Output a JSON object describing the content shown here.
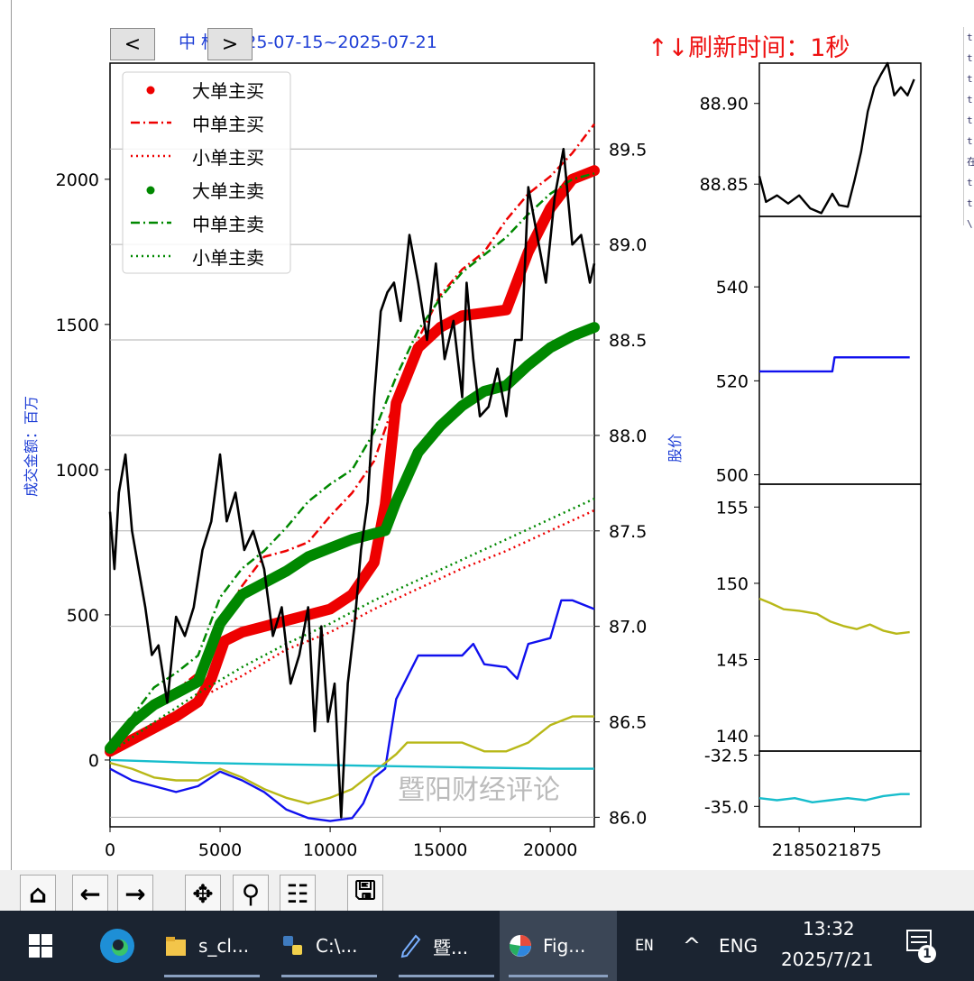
{
  "window": {
    "right_strip_chars": [
      "t",
      "t",
      "t",
      "t",
      "t",
      "t",
      "在",
      "t",
      "t",
      "\\"
    ]
  },
  "nav": {
    "prev_label": "<",
    "next_label": ">"
  },
  "header": {
    "title": "中          标 2025-07-15~2025-07-21",
    "refresh": "↑↓刷新时间：1秒",
    "title_color": "#1f3fd6",
    "refresh_color": "#ee1111"
  },
  "watermark": "暨阳财经评论",
  "chart_data": [
    {
      "type": "line",
      "id": "main",
      "ylabel_left": "成交金额：百万",
      "ylabel_right": "股价",
      "xlim": [
        0,
        22000
      ],
      "ylim_left": [
        -230,
        2400
      ],
      "ylim_right": [
        85.95,
        89.95
      ],
      "x_ticks": [
        0,
        5000,
        10000,
        15000,
        20000
      ],
      "y_ticks_left": [
        0,
        500,
        1000,
        1500,
        2000
      ],
      "y_ticks_right": [
        "86.0",
        "86.5",
        "87.0",
        "87.5",
        "88.0",
        "88.5",
        "89.0",
        "89.5"
      ],
      "grid": "horizontal",
      "legend": {
        "position": "top-left",
        "entries": [
          {
            "label": "大单主买",
            "color": "#ee0000",
            "style": "dot"
          },
          {
            "label": "中单主买",
            "color": "#ee0000",
            "style": "dashdot"
          },
          {
            "label": "小单主买",
            "color": "#ee0000",
            "style": "dotted"
          },
          {
            "label": "大单主卖",
            "color": "#008800",
            "style": "dot"
          },
          {
            "label": "中单主卖",
            "color": "#008800",
            "style": "dashdot"
          },
          {
            "label": "小单主卖",
            "color": "#008800",
            "style": "dotted"
          }
        ]
      },
      "series": [
        {
          "name": "大单主买",
          "axis": "left",
          "color": "#ee0000",
          "style": "thick",
          "x": [
            0,
            1000,
            2000,
            3000,
            4000,
            4600,
            5200,
            6000,
            7000,
            8000,
            9000,
            10000,
            11000,
            12000,
            12500,
            13000,
            14000,
            15000,
            16000,
            17000,
            18000,
            19000,
            20000,
            21000,
            22000
          ],
          "y": [
            30,
            70,
            110,
            150,
            200,
            280,
            410,
            440,
            460,
            480,
            500,
            520,
            570,
            680,
            880,
            1230,
            1420,
            1490,
            1530,
            1540,
            1550,
            1750,
            1900,
            2000,
            2030
          ]
        },
        {
          "name": "中单主买",
          "axis": "left",
          "color": "#ee0000",
          "style": "dashdot",
          "x": [
            0,
            1000,
            2000,
            3000,
            4000,
            5000,
            6000,
            7000,
            8000,
            9000,
            10000,
            11000,
            12000,
            13000,
            14000,
            15000,
            16000,
            17000,
            18000,
            19000,
            20000,
            21000,
            22000
          ],
          "y": [
            30,
            140,
            190,
            240,
            300,
            480,
            600,
            700,
            720,
            750,
            840,
            920,
            1030,
            1250,
            1450,
            1600,
            1690,
            1750,
            1860,
            1950,
            2010,
            2090,
            2190
          ]
        },
        {
          "name": "小单主买",
          "axis": "left",
          "color": "#ee0000",
          "style": "dotted",
          "x": [
            0,
            2000,
            4000,
            6000,
            8000,
            10000,
            12000,
            14000,
            16000,
            18000,
            20000,
            22000
          ],
          "y": [
            20,
            120,
            210,
            290,
            380,
            440,
            520,
            590,
            660,
            720,
            790,
            860
          ]
        },
        {
          "name": "大单主卖",
          "axis": "left",
          "color": "#008800",
          "style": "thick",
          "x": [
            0,
            1000,
            2000,
            3000,
            4000,
            5000,
            6000,
            7000,
            8000,
            9000,
            10000,
            11000,
            12000,
            12500,
            13000,
            14000,
            15000,
            16000,
            17000,
            18000,
            19000,
            20000,
            21000,
            22000
          ],
          "y": [
            40,
            130,
            190,
            230,
            270,
            470,
            570,
            610,
            650,
            700,
            730,
            760,
            780,
            790,
            890,
            1060,
            1150,
            1220,
            1270,
            1290,
            1360,
            1420,
            1460,
            1490
          ]
        },
        {
          "name": "中单主卖",
          "axis": "left",
          "color": "#008800",
          "style": "dashdot",
          "x": [
            0,
            1000,
            2000,
            3000,
            4000,
            5000,
            6000,
            7000,
            8000,
            9000,
            10000,
            11000,
            12000,
            13000,
            14000,
            15000,
            16000,
            17000,
            18000,
            19000,
            20000,
            21000,
            22000
          ],
          "y": [
            40,
            150,
            250,
            300,
            360,
            560,
            660,
            720,
            800,
            890,
            950,
            1000,
            1130,
            1320,
            1480,
            1590,
            1680,
            1740,
            1800,
            1880,
            1950,
            2000,
            2020
          ]
        },
        {
          "name": "小单主卖",
          "axis": "left",
          "color": "#008800",
          "style": "dotted",
          "x": [
            0,
            2000,
            4000,
            6000,
            8000,
            10000,
            12000,
            14000,
            16000,
            18000,
            20000,
            22000
          ],
          "y": [
            25,
            130,
            230,
            320,
            400,
            470,
            550,
            620,
            690,
            760,
            830,
            900
          ]
        },
        {
          "axis": "left",
          "color": "#1010ee",
          "style": "line",
          "x": [
            0,
            1000,
            2000,
            3000,
            4000,
            5000,
            6000,
            7000,
            8000,
            9000,
            10000,
            11000,
            11500,
            12000,
            12500,
            13000,
            14000,
            15000,
            16000,
            16500,
            17000,
            18000,
            18500,
            19000,
            20000,
            20500,
            21000,
            22000
          ],
          "y": [
            -30,
            -70,
            -90,
            -110,
            -90,
            -40,
            -70,
            -110,
            -170,
            -200,
            -210,
            -200,
            -150,
            -60,
            -30,
            210,
            360,
            360,
            360,
            400,
            330,
            320,
            280,
            400,
            420,
            550,
            550,
            520
          ]
        },
        {
          "axis": "left",
          "color": "#b8b818",
          "style": "line",
          "x": [
            0,
            1000,
            2000,
            3000,
            4000,
            5000,
            6000,
            7000,
            8000,
            9000,
            10000,
            11000,
            12000,
            13000,
            13500,
            14000,
            15000,
            16000,
            17000,
            18000,
            19000,
            20000,
            21000,
            22000
          ],
          "y": [
            -10,
            -30,
            -60,
            -70,
            -70,
            -30,
            -60,
            -100,
            -130,
            -150,
            -130,
            -100,
            -40,
            20,
            60,
            60,
            60,
            60,
            30,
            30,
            60,
            120,
            150,
            150
          ]
        },
        {
          "axis": "left",
          "color": "#17bdcc",
          "style": "line",
          "x": [
            0,
            4000,
            8000,
            12000,
            16000,
            20000,
            22000
          ],
          "y": [
            0,
            -10,
            -15,
            -20,
            -25,
            -30,
            -30
          ]
        },
        {
          "axis": "right",
          "color": "#000000",
          "style": "line",
          "x": [
            0,
            200,
            400,
            700,
            1000,
            1300,
            1600,
            1900,
            2200,
            2600,
            3000,
            3400,
            3800,
            4200,
            4600,
            5000,
            5300,
            5700,
            6100,
            6500,
            7000,
            7400,
            7800,
            8200,
            8600,
            9000,
            9300,
            9600,
            9900,
            10200,
            10500,
            10800,
            11100,
            11400,
            11700,
            12000,
            12300,
            12600,
            12900,
            13200,
            13600,
            14000,
            14400,
            14800,
            15200,
            15600,
            16000,
            16200,
            16500,
            16800,
            17200,
            17600,
            18000,
            18400,
            18700,
            19000,
            19400,
            19800,
            20200,
            20600,
            21000,
            21400,
            21800,
            22000
          ],
          "y": [
            87.6,
            87.3,
            87.7,
            87.9,
            87.5,
            87.3,
            87.1,
            86.85,
            86.9,
            86.6,
            87.05,
            86.95,
            87.1,
            87.4,
            87.55,
            87.9,
            87.55,
            87.7,
            87.4,
            87.5,
            87.3,
            86.95,
            87.1,
            86.7,
            86.85,
            87.1,
            86.45,
            87.0,
            86.5,
            86.7,
            86.0,
            86.7,
            87.0,
            87.4,
            87.65,
            88.2,
            88.65,
            88.75,
            88.8,
            88.6,
            89.05,
            88.8,
            88.5,
            88.9,
            88.4,
            88.6,
            88.2,
            88.8,
            88.4,
            88.1,
            88.15,
            88.35,
            88.1,
            88.5,
            88.5,
            89.3,
            89.05,
            88.8,
            89.25,
            89.5,
            89.0,
            89.05,
            88.8,
            88.9
          ]
        }
      ]
    },
    {
      "type": "line",
      "id": "sub1",
      "xlim": [
        21832,
        21905
      ],
      "ylim": [
        88.83,
        88.925
      ],
      "y_ticks": [
        "88.85",
        "88.90"
      ],
      "series": [
        {
          "color": "#000000",
          "x": [
            21832,
            21835,
            21840,
            21845,
            21850,
            21855,
            21860,
            21865,
            21868,
            21872,
            21875,
            21878,
            21881,
            21884,
            21887,
            21890,
            21893,
            21896,
            21899,
            21902
          ],
          "y": [
            88.855,
            88.839,
            88.843,
            88.838,
            88.843,
            88.835,
            88.832,
            88.844,
            88.837,
            88.836,
            88.852,
            88.87,
            88.895,
            88.91,
            88.918,
            88.925,
            88.905,
            88.91,
            88.905,
            88.915
          ]
        }
      ]
    },
    {
      "type": "line",
      "id": "sub2",
      "xlim": [
        21832,
        21905
      ],
      "ylim": [
        498,
        555
      ],
      "y_ticks": [
        "500",
        "520",
        "540"
      ],
      "series": [
        {
          "color": "#1010ee",
          "x": [
            21832,
            21850,
            21865,
            21866,
            21880,
            21900
          ],
          "y": [
            522,
            522,
            522,
            525,
            525,
            525
          ]
        }
      ]
    },
    {
      "type": "line",
      "id": "sub3",
      "xlim": [
        21832,
        21905
      ],
      "ylim": [
        139,
        156.5
      ],
      "y_ticks": [
        "140",
        "145",
        "150",
        "155"
      ],
      "series": [
        {
          "color": "#b8b818",
          "x": [
            21832,
            21837,
            21843,
            21850,
            21858,
            21864,
            21870,
            21876,
            21882,
            21888,
            21894,
            21900
          ],
          "y": [
            149.0,
            148.7,
            148.3,
            148.2,
            148.0,
            147.5,
            147.2,
            147.0,
            147.3,
            146.9,
            146.7,
            146.8
          ]
        }
      ]
    },
    {
      "type": "line",
      "id": "sub4",
      "xlim": [
        21832,
        21905
      ],
      "ylim": [
        -36.0,
        -32.3
      ],
      "y_ticks": [
        "-32.5",
        "-35.0"
      ],
      "x_ticks": [
        21850,
        21875
      ],
      "series": [
        {
          "color": "#17bdcc",
          "x": [
            21832,
            21840,
            21848,
            21856,
            21864,
            21872,
            21880,
            21888,
            21896,
            21900
          ],
          "y": [
            -34.6,
            -34.7,
            -34.6,
            -34.8,
            -34.7,
            -34.6,
            -34.7,
            -34.5,
            -34.4,
            -34.4
          ]
        }
      ]
    }
  ],
  "toolbar": {
    "icons": [
      "home-icon",
      "back-arrow-icon",
      "forward-arrow-icon",
      "pan-icon",
      "zoom-icon",
      "configure-icon",
      "save-icon"
    ],
    "glyphs": [
      "⌂",
      "←",
      "→",
      "✥",
      "⚲",
      "☷",
      "🖫"
    ]
  },
  "taskbar": {
    "items": [
      {
        "label": "s_cl...",
        "icon": "folder-icon"
      },
      {
        "label": "C:\\...",
        "icon": "python-icon"
      },
      {
        "label": "暨...",
        "icon": "pen-icon"
      },
      {
        "label": "Fig...",
        "icon": "figure-icon"
      }
    ],
    "en": "EN",
    "chevron": "^",
    "lang": "ENG",
    "time": "13:32",
    "date": "2025/7/21",
    "notif_count": "1"
  }
}
